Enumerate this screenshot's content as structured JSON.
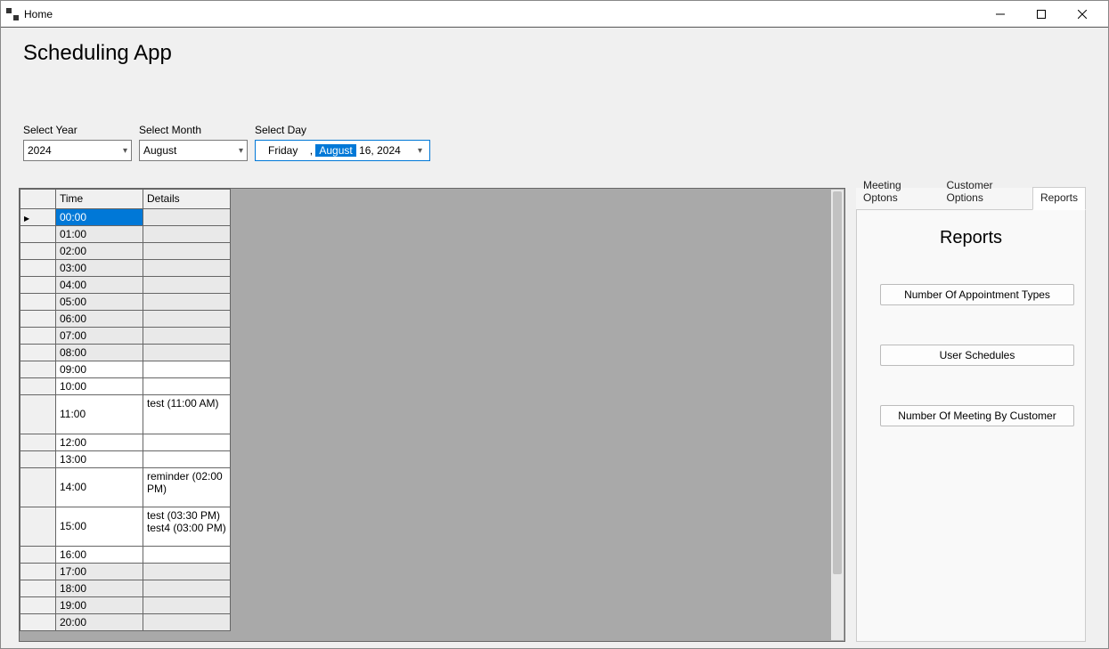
{
  "window": {
    "title": "Home"
  },
  "heading": "Scheduling App",
  "selectors": {
    "year": {
      "label": "Select Year",
      "value": "2024"
    },
    "month": {
      "label": "Select Month",
      "value": "August"
    },
    "day": {
      "label": "Select Day",
      "weekday": "Friday",
      "comma": ",",
      "month": "August",
      "rest": "16, 2024"
    }
  },
  "grid": {
    "headers": [
      "",
      "Time",
      "Details"
    ],
    "rows": [
      {
        "time": "00:00",
        "details": "",
        "stripe": true,
        "selected": true,
        "current": true
      },
      {
        "time": "01:00",
        "details": "",
        "stripe": true
      },
      {
        "time": "02:00",
        "details": "",
        "stripe": true
      },
      {
        "time": "03:00",
        "details": "",
        "stripe": true
      },
      {
        "time": "04:00",
        "details": "",
        "stripe": true
      },
      {
        "time": "05:00",
        "details": "",
        "stripe": true
      },
      {
        "time": "06:00",
        "details": "",
        "stripe": true
      },
      {
        "time": "07:00",
        "details": "",
        "stripe": true
      },
      {
        "time": "08:00",
        "details": "",
        "stripe": true
      },
      {
        "time": "09:00",
        "details": "",
        "stripe": false
      },
      {
        "time": "10:00",
        "details": "",
        "stripe": false
      },
      {
        "time": "11:00",
        "details": "test (11:00 AM)",
        "stripe": false,
        "tall": true
      },
      {
        "time": "12:00",
        "details": "",
        "stripe": false
      },
      {
        "time": "13:00",
        "details": "",
        "stripe": false
      },
      {
        "time": "14:00",
        "details": "reminder (02:00 PM)",
        "stripe": false,
        "tall": true
      },
      {
        "time": "15:00",
        "details": "test (03:30 PM)\ntest4 (03:00 PM)",
        "stripe": false,
        "tall": true
      },
      {
        "time": "16:00",
        "details": "",
        "stripe": false
      },
      {
        "time": "17:00",
        "details": "",
        "stripe": true
      },
      {
        "time": "18:00",
        "details": "",
        "stripe": true
      },
      {
        "time": "19:00",
        "details": "",
        "stripe": true
      },
      {
        "time": "20:00",
        "details": "",
        "stripe": true
      }
    ]
  },
  "tabs": {
    "items": [
      "Meeting Optons",
      "Customer Options",
      "Reports"
    ],
    "activeIndex": 2,
    "panel": {
      "title": "Reports",
      "buttons": [
        "Number Of Appointment Types",
        "User Schedules",
        "Number Of Meeting By Customer"
      ]
    }
  }
}
